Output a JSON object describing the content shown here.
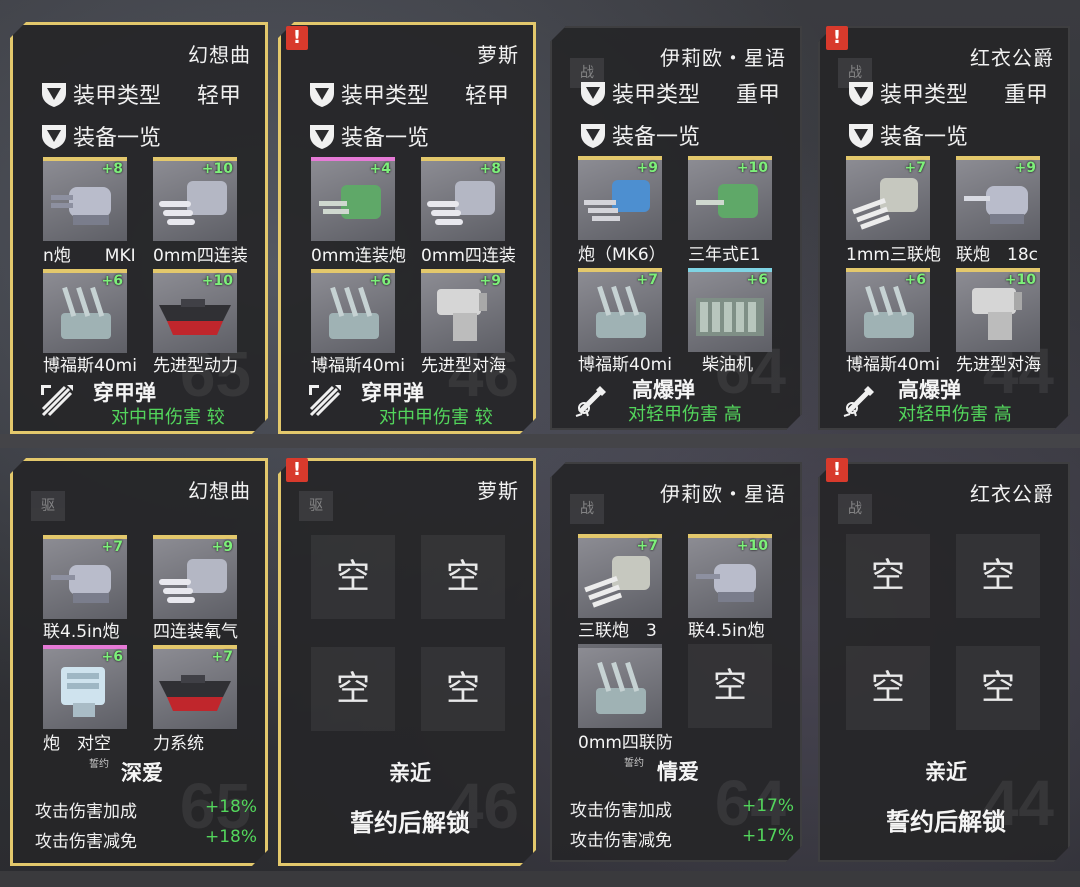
{
  "common": {
    "armor_label": "装甲类型",
    "equip_label": "装备一览",
    "empty": "空",
    "stat_attack": "攻击伤害加成",
    "stat_defense": "攻击伤害减免",
    "unlock_text": "誓约后解锁",
    "alert": "!",
    "oath_stamp": "誓约"
  },
  "top": [
    {
      "name": "幻想曲",
      "armor": "轻甲",
      "ghost": "65",
      "slots": [
        {
          "level": "+8",
          "label": "n炮　　MKI",
          "icon": "single-turret-icon"
        },
        {
          "level": "+10",
          "label": "0mm四连装",
          "icon": "triple-turret-icon"
        },
        {
          "level": "+6",
          "label": "博福斯40mi",
          "icon": "aa-gun-icon"
        },
        {
          "level": "+10",
          "label": "先进型动力",
          "icon": "engine-hull-icon"
        }
      ],
      "ammo": {
        "title": "穿甲弹",
        "sub": "对中甲伤害 较",
        "icon": "ap-shell-icon"
      }
    },
    {
      "name": "萝斯",
      "armor": "轻甲",
      "ghost": "46",
      "slots": [
        {
          "level": "+4",
          "label": "0mm连装炮",
          "icon": "green-turret-icon"
        },
        {
          "level": "+8",
          "label": "0mm四连装",
          "icon": "triple-turret-icon"
        },
        {
          "level": "+6",
          "label": "博福斯40mi",
          "icon": "aa-gun-icon"
        },
        {
          "level": "+9",
          "label": "先进型对海",
          "icon": "radar-icon"
        }
      ],
      "ammo": {
        "title": "穿甲弹",
        "sub": "对中甲伤害 较",
        "icon": "ap-shell-icon"
      }
    },
    {
      "name": "伊莉欧・星语",
      "armor": "重甲",
      "ghost": "64",
      "slots": [
        {
          "level": "+9",
          "label": "炮（MK6）",
          "icon": "blue-turret-icon"
        },
        {
          "level": "+10",
          "label": "三年式E1",
          "icon": "green-turret-icon"
        },
        {
          "level": "+7",
          "label": "博福斯40mi",
          "icon": "aa-gun-icon"
        },
        {
          "level": "+6",
          "label": "柴油机",
          "icon": "diesel-engine-icon"
        }
      ],
      "ammo": {
        "title": "高爆弹",
        "sub": "对轻甲伤害 高",
        "icon": "he-shell-icon"
      }
    },
    {
      "name": "红衣公爵",
      "armor": "重甲",
      "ghost": "44",
      "slots": [
        {
          "level": "+7",
          "label": "1mm三联炮",
          "icon": "triple-turret-icon"
        },
        {
          "level": "+9",
          "label": "联炮　18c",
          "icon": "single-turret-icon"
        },
        {
          "level": "+6",
          "label": "博福斯40mi",
          "icon": "aa-gun-icon"
        },
        {
          "level": "+10",
          "label": "先进型对海",
          "icon": "radar-icon"
        }
      ],
      "ammo": {
        "title": "高爆弹",
        "sub": "对轻甲伤害 高",
        "icon": "he-shell-icon"
      }
    }
  ],
  "bottom": [
    {
      "name": "幻想曲",
      "type": "驱",
      "ghost": "65",
      "slots": [
        {
          "level": "+7",
          "label": "联4.5in炮",
          "icon": "single-turret-icon"
        },
        {
          "level": "+9",
          "label": "四连装氧气",
          "icon": "triple-turret-icon"
        },
        {
          "level": "+6",
          "label": "炮　对空",
          "icon": "aa-director-icon"
        },
        {
          "level": "+7",
          "label": "力系统",
          "icon": "engine-hull-icon"
        }
      ],
      "affection": "深爱",
      "stats": [
        "+18%",
        "+18%"
      ]
    },
    {
      "name": "萝斯",
      "type": "驱",
      "ghost": "46",
      "affection": "亲近"
    },
    {
      "name": "伊莉欧・星语",
      "type": "战",
      "ghost": "64",
      "slots": [
        {
          "level": "+7",
          "label": "三联炮　3",
          "icon": "triple-turret-icon"
        },
        {
          "level": "+10",
          "label": "联4.5in炮",
          "icon": "single-turret-icon"
        },
        {
          "level": "",
          "label": "0mm四联防",
          "icon": "aa-gun-icon"
        }
      ],
      "affection": "情爱",
      "stats": [
        "+17%",
        "+17%"
      ]
    },
    {
      "name": "红衣公爵",
      "type": "战",
      "ghost": "44",
      "affection": "亲近"
    }
  ],
  "colors": {
    "gold": "#e3c86c",
    "green": "#53d65c",
    "alert": "#d83a2c"
  }
}
